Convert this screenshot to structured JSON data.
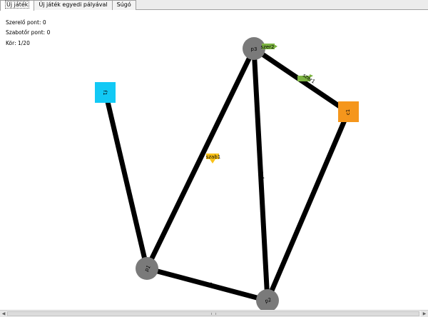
{
  "tabs": [
    {
      "label": "Új játék",
      "active": true
    },
    {
      "label": "Új játék egyedi pályával",
      "active": false
    },
    {
      "label": "Súgó",
      "active": false
    }
  ],
  "status": {
    "fixer_points": "Szerelő pont: 0",
    "saboteur_points": "Szabotőr pont: 0",
    "round": "Kör: 1/20"
  },
  "map": {
    "nodes": {
      "f1": {
        "label": "f1",
        "kind": "source",
        "color": "#12c9f5"
      },
      "c1": {
        "label": "c1",
        "kind": "cistern",
        "color": "#f5961c"
      },
      "p1": {
        "label": "p1",
        "kind": "pump",
        "color": "#7a7a7a"
      },
      "p2": {
        "label": "p2",
        "kind": "pump",
        "color": "#7a7a7a"
      },
      "p3": {
        "label": "p3",
        "kind": "pump",
        "color": "#7a7a7a"
      }
    },
    "pipes": {
      "cs1": "cs1",
      "cs2": "cs2",
      "cs3": "cs3",
      "cs4": "cs4",
      "cs5": "cs5",
      "cs6": "cs6"
    },
    "players": {
      "szer2": {
        "label": "szer2",
        "color": "#7cb342"
      },
      "szer1": {
        "label": "szer1",
        "color": "#7cb342"
      },
      "szab1": {
        "label": "szab1",
        "color": "#f9c21a"
      }
    }
  },
  "icons": {
    "scroll_left": "scroll-left-arrow-icon",
    "scroll_right": "scroll-right-arrow-icon"
  }
}
